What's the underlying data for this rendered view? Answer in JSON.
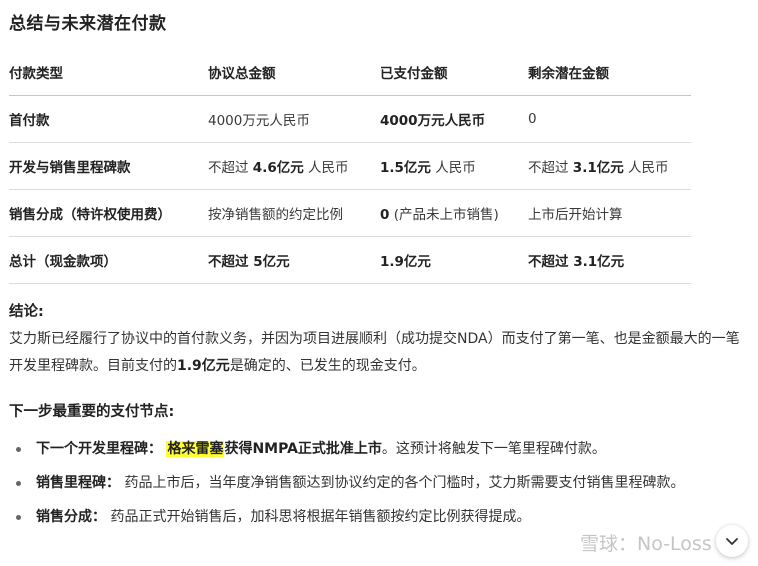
{
  "title": "总结与未来潜在付款",
  "table": {
    "headers": [
      "付款类型",
      "协议总金额",
      "已支付金额",
      "剩余潜在金额"
    ],
    "rows": [
      {
        "type": "首付款",
        "total": {
          "pre": "",
          "bold": "",
          "post": "4000万元人民币"
        },
        "paid": {
          "pre": "",
          "bold": "4000万元人民币",
          "post": ""
        },
        "remaining": {
          "pre": "",
          "bold": "",
          "post": "0"
        }
      },
      {
        "type": "开发与销售里程碑款",
        "total": {
          "pre": "不超过 ",
          "bold": "4.6亿元",
          "post": " 人民币"
        },
        "paid": {
          "pre": "",
          "bold": "1.5亿元",
          "post": " 人民币"
        },
        "remaining": {
          "pre": "不超过 ",
          "bold": "3.1亿元",
          "post": " 人民币"
        }
      },
      {
        "type": "销售分成（特许权使用费）",
        "total": {
          "pre": "",
          "bold": "",
          "post": "按净销售额的约定比例"
        },
        "paid": {
          "pre": "",
          "bold": "0",
          "post": " (产品未上市销售)"
        },
        "remaining": {
          "pre": "",
          "bold": "",
          "post": "上市后开始计算"
        }
      },
      {
        "type": "总计（现金款项）",
        "total": {
          "pre": "",
          "bold": "不超过 5亿元",
          "post": ""
        },
        "paid": {
          "pre": "",
          "bold": "1.9亿元",
          "post": ""
        },
        "remaining": {
          "pre": "",
          "bold": "不超过 3.1亿元",
          "post": ""
        }
      }
    ]
  },
  "conclusion": {
    "heading": "结论:",
    "text1": "艾力斯已经履行了协议中的首付款义务，并因为项目进展顺利（成功提交NDA）而支付了第一笔、也是金额最大的一笔开发里程碑款。目前支付的",
    "bold": "1.9亿元",
    "text2": "是确定的、已发生的现金支付。"
  },
  "next_steps": {
    "heading": "下一步最重要的支付节点:",
    "items": [
      {
        "label": "下一个开发里程碑：",
        "highlight": "格来雷塞",
        "bold2": "获得NMPA正式批准上市",
        "text": "。这预计将触发下一笔里程碑付款。"
      },
      {
        "label": "销售里程碑：",
        "highlight": "",
        "bold2": "",
        "text": "药品上市后，当年度净销售额达到协议约定的各个门槛时，艾力斯需要支付销售里程碑款。"
      },
      {
        "label": "销售分成：",
        "highlight": "",
        "bold2": "",
        "text": "药品正式开始销售后，加科思将根据年销售额按约定比例获得提成。"
      }
    ]
  },
  "watermark": "雪球：No-Loss",
  "scroll_button": {
    "icon": "chevron-down-icon"
  }
}
